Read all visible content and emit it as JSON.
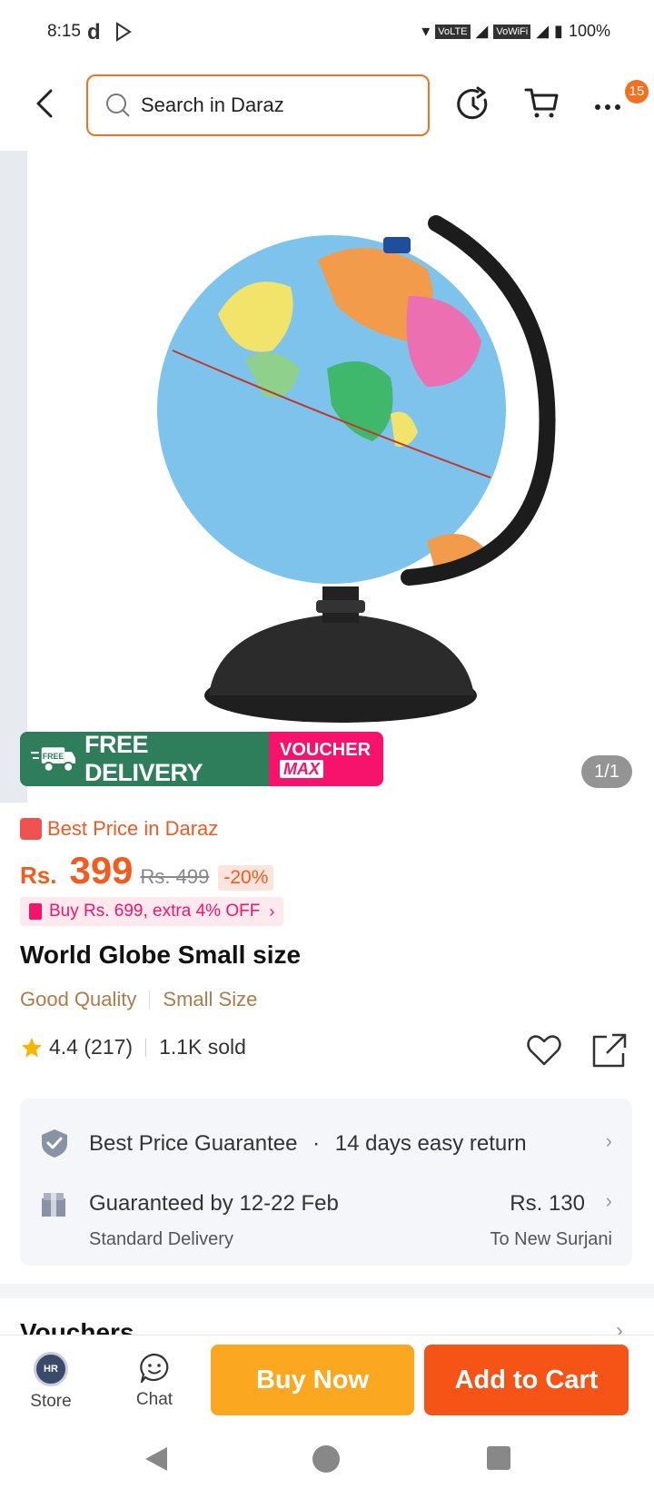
{
  "status_bar": {
    "time": "8:15",
    "app_letter": "d",
    "network_1": "VoLTE",
    "network_2": "VoWiFi",
    "battery": "100%"
  },
  "header": {
    "search_placeholder": "Search in Daraz",
    "cart_badge_count": "15"
  },
  "gallery": {
    "free_delivery_tag": "FREE",
    "free_delivery_label": "FREE DELIVERY",
    "voucher_top": "VOUCHER",
    "voucher_bottom": "MAX",
    "page_indicator": "1/1"
  },
  "product": {
    "best_price_label": "Best Price in Daraz",
    "currency": "Rs.",
    "price": "399",
    "original_price": "Rs. 499",
    "discount": "-20%",
    "offer_text": "Buy Rs. 699, extra 4% OFF",
    "title": "World Globe Small size",
    "tags": [
      "Good Quality",
      "Small Size"
    ],
    "rating": "4.4 (217)",
    "sold": "1.1K sold"
  },
  "service": {
    "guarantee_1": "Best Price Guarantee",
    "guarantee_sep": "·",
    "guarantee_2": "14 days easy return",
    "delivery_title": "Guaranteed by 12-22 Feb",
    "delivery_type": "Standard Delivery",
    "delivery_fee": "Rs. 130",
    "delivery_destination": "To New Surjani"
  },
  "vouchers": {
    "title": "Vouchers"
  },
  "bottom_bar": {
    "store_label": "Store",
    "store_avatar_text": "HR",
    "chat_label": "Chat",
    "buy_now_label": "Buy Now",
    "add_to_cart_label": "Add to Cart"
  },
  "colors": {
    "accent_orange": "#f36f21",
    "buy_now": "#fba820",
    "add_to_cart": "#f55416",
    "free_delivery_green": "#2e7d5b",
    "voucher_pink": "#f5136c"
  }
}
